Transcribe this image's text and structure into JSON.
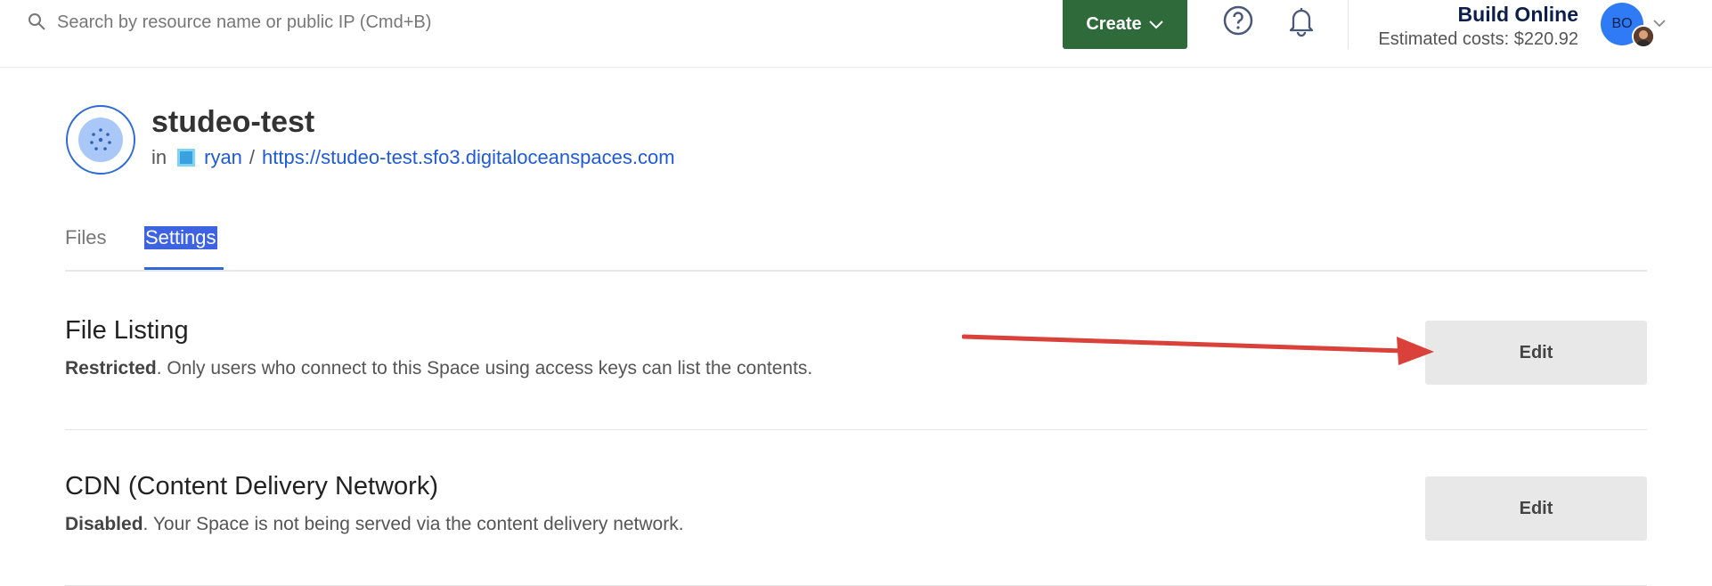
{
  "search": {
    "placeholder": "Search by resource name or public IP (Cmd+B)"
  },
  "topbar": {
    "create_label": "Create",
    "account_name": "Build Online",
    "estimated_costs": "Estimated costs: $220.92",
    "avatar_initials": "BO"
  },
  "space": {
    "name": "studeo-test",
    "in_label": "in",
    "project": "ryan",
    "separator": "/",
    "url": "https://studeo-test.sfo3.digitaloceanspaces.com"
  },
  "tabs": [
    {
      "label": "Files"
    },
    {
      "label": "Settings"
    }
  ],
  "sections": [
    {
      "title": "File Listing",
      "status": "Restricted",
      "description": ". Only users who connect to this Space using access keys can list the contents.",
      "button": "Edit"
    },
    {
      "title": "CDN (Content Delivery Network)",
      "status": "Disabled",
      "description": ". Your Space is not being served via the content delivery network.",
      "button": "Edit"
    }
  ],
  "colors": {
    "create_button": "#2f6b3a",
    "link": "#1f5bd8",
    "tab_selected_highlight": "#3d63e0",
    "annotation_arrow": "#d9413a",
    "avatar": "#2f7bf5"
  },
  "icons": [
    "search-icon",
    "chevron-down-icon",
    "help-icon",
    "bell-icon",
    "space-icon",
    "project-icon"
  ]
}
